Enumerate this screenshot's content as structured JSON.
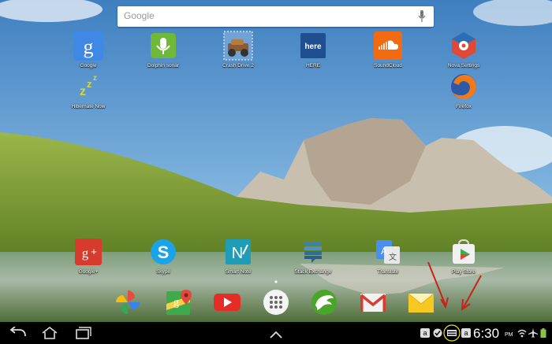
{
  "search": {
    "placeholder": "Google"
  },
  "apps": [
    {
      "label": "Google",
      "icon": "google-search-icon"
    },
    {
      "label": "Dolphin sonar",
      "icon": "dolphin-sonar-mic-icon"
    },
    {
      "label": "Crash Drive 2",
      "icon": "crash-drive-2-icon"
    },
    {
      "label": "HERE",
      "icon": "here-maps-icon"
    },
    {
      "label": "SoundCloud",
      "icon": "soundcloud-icon"
    },
    {
      "label": "Nova Settings",
      "icon": "nova-settings-icon"
    },
    {
      "label": "Hibernate Now",
      "icon": "hibernate-zzz-icon"
    },
    {
      "label": "Firefox",
      "icon": "firefox-icon"
    },
    {
      "label": "Google+",
      "icon": "google-plus-icon"
    },
    {
      "label": "Skype",
      "icon": "skype-icon"
    },
    {
      "label": "Smart Note",
      "icon": "smart-note-icon"
    },
    {
      "label": "Stack Exchange",
      "icon": "stack-exchange-icon"
    },
    {
      "label": "Translate",
      "icon": "translate-icon"
    },
    {
      "label": "Play Store",
      "icon": "play-store-icon"
    }
  ],
  "dock": [
    "photos-icon",
    "maps-icon",
    "youtube-icon",
    "app-drawer-icon",
    "dolphin-browser-icon",
    "gmail-icon",
    "email-icon"
  ],
  "statusbar": {
    "time": "6:30",
    "ampm": "PM",
    "notif_a1": "a",
    "notif_a2": "a"
  }
}
